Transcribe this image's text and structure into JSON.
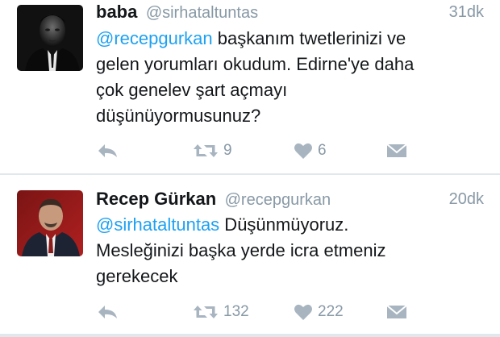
{
  "tweets": [
    {
      "name": "baba",
      "handle": "@sirhataltuntas",
      "time": "31dk",
      "mention": "@recepgurkan",
      "text": " başkanım twetlerinizi ve\ngelen yorumları okudum. Edirne'ye daha\nçok genelev şart açmayı\ndüşünüyormusunuz?",
      "retweets": "9",
      "likes": "6"
    },
    {
      "name": "Recep Gürkan",
      "handle": "@recepgurkan",
      "time": "20dk",
      "mention": "@sirhataltuntas",
      "text": " Düşünmüyoruz.\nMesleğinizi başka yerde icra etmeniz\ngerekecek",
      "retweets": "132",
      "likes": "222"
    }
  ],
  "icons": {
    "reply": "reply-icon",
    "retweet": "retweet-icon",
    "like": "heart-icon",
    "message": "envelope-icon"
  },
  "colors": {
    "mention": "#1da1f2",
    "meta": "#8899a6",
    "icon": "#a8b5c0"
  }
}
